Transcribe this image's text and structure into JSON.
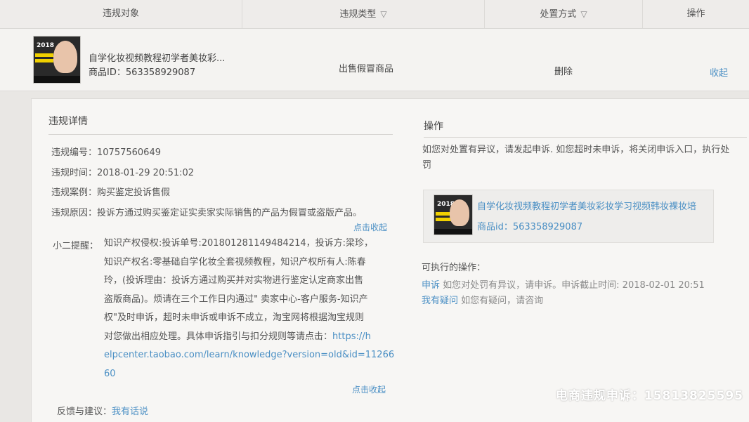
{
  "table_header": {
    "target": "违规对象",
    "type": "违规类型",
    "method": "处置方式",
    "action": "操作"
  },
  "product_row": {
    "thumb_year": "2018",
    "title": "自学化妆视频教程初学者美妆彩...",
    "id_text": "商品ID：563358929087",
    "type": "出售假冒商品",
    "method": "删除",
    "action": "收起"
  },
  "details": {
    "title": "违规详情",
    "number": "违规编号：10757560649",
    "time": "违规时间：2018-01-29 20:51:02",
    "case": "违规案例：购买鉴定投诉售假",
    "reason": "违规原因：投诉方通过购买鉴定证实卖家实际销售的产品为假冒或盗版产品。",
    "collapse1": "点击收起",
    "tip_label": "小二提醒：",
    "tip_lines": [
      "知识产权侵权:投诉单号:201801281149484214，投诉方:梁珍，",
      "知识产权名:零基础自学化妆全套视频教程，知识产权所有人:陈春",
      "玲，(投诉理由：投诉方通过购买并对实物进行鉴定认定商家出售",
      "盗版商品)。烦请在三个工作日内通过\" 卖家中心-客户服务-知识产",
      "权\"及时申诉，超时未申诉或申诉不成立，淘宝网将根据淘宝规则",
      "对您做出相应处理。具体申诉指引与扣分规则等请点击："
    ],
    "tip_link_start": "https://h",
    "tip_link_cont": [
      "elpcenter.taobao.com/learn/knowledge?version=old&id=11266",
      "60"
    ],
    "collapse2": "点击收起",
    "feedback_label": "反馈与建议：",
    "feedback_link": "我有话说"
  },
  "operations": {
    "title": "操作",
    "notice_lines": [
      "如您对处置有异议，请发起申诉. 如您超时未申诉，将关闭申诉入口，执行处",
      "罚"
    ],
    "card_title": "自学化妆视频教程初学者美妆彩妆学习视频韩妆裸妆培",
    "card_id": "商品id：563358929087",
    "available_label": "可执行的操作：",
    "appeal_link": "申诉",
    "appeal_text": "如您对处罚有异议，请申诉。申诉截止时间: 2018-02-01 20:51",
    "question_link": "我有疑问",
    "question_text": "如您有疑问，请咨询"
  },
  "watermark": "电商违规申诉：15813825595",
  "colors": {
    "link": "#4a8fc4",
    "background": "#e9e7e4"
  }
}
